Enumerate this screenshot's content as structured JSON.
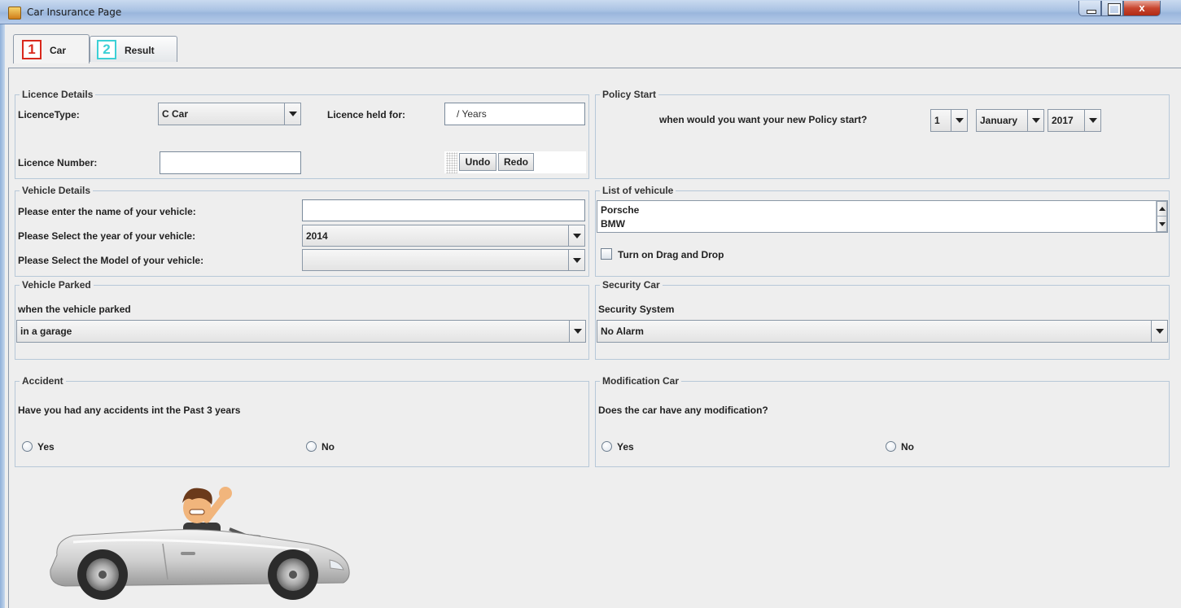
{
  "window": {
    "title": "Car Insurance Page",
    "close_glyph": "x"
  },
  "tabs": [
    {
      "number": "1",
      "label": "Car",
      "color": "#d9281c"
    },
    {
      "number": "2",
      "label": "Result",
      "color": "#3cd0d6"
    }
  ],
  "licence": {
    "legend": "Licence Details",
    "type_label": "LicenceType:",
    "type_value": "C Car",
    "held_label": "Licence held for:",
    "held_value": "/ Years",
    "number_label": "Licence Number:",
    "number_value": "",
    "undo_label": "Undo",
    "redo_label": "Redo"
  },
  "policy": {
    "legend": "Policy Start",
    "question": "when would you want your new Policy start?",
    "day": "1",
    "month": "January",
    "year": "2017"
  },
  "vehicle": {
    "legend": "Vehicle Details",
    "name_label": "Please enter the name of your vehicle:",
    "name_value": "",
    "year_label": "Please Select the year of your vehicle:",
    "year_value": "2014",
    "model_label": "Please Select the Model of your vehicle:",
    "model_value": ""
  },
  "vehicle_list": {
    "legend": "List of vehicule",
    "items": [
      "Porsche",
      "BMW"
    ],
    "dnd_label": "Turn on Drag and Drop"
  },
  "parked": {
    "legend": "Vehicle Parked",
    "question": "when the vehicle parked",
    "value": "in a garage"
  },
  "security": {
    "legend": "Security Car",
    "question": "Security System",
    "value": "No Alarm"
  },
  "accident": {
    "legend": "Accident",
    "question": "Have you had any accidents int the Past 3 years",
    "yes": "Yes",
    "no": "No"
  },
  "modification": {
    "legend": "Modification Car",
    "question": "Does the car have any modification?",
    "yes": "Yes",
    "no": "No"
  },
  "illustration": {
    "icon": "car-driver-illustration"
  }
}
